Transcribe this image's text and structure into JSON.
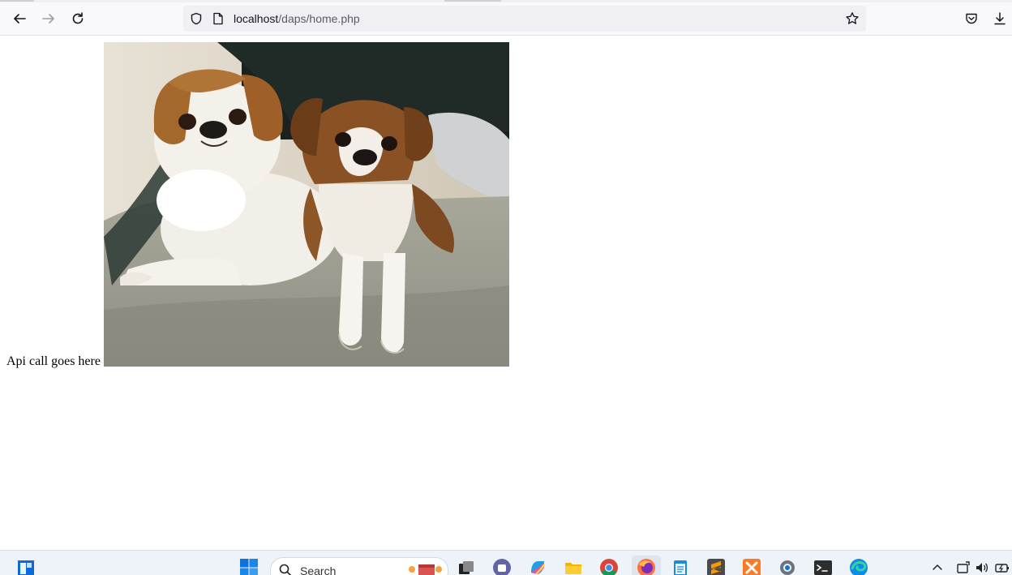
{
  "browser": {
    "url_host": "localhost",
    "url_path": "/daps/home.php",
    "icons": {
      "back": "back-arrow-icon",
      "forward": "forward-arrow-icon",
      "reload": "reload-icon",
      "shield": "shield-icon",
      "page": "page-icon",
      "bookmark": "star-icon",
      "pocket": "pocket-icon",
      "downloads": "download-icon"
    }
  },
  "page": {
    "api_text": "Api call goes here",
    "image_subject": "dog-photo"
  },
  "taskbar": {
    "search_label": "Search",
    "apps": [
      "start-icon",
      "task-view-icon",
      "teams-icon",
      "copilot-icon",
      "file-explorer-icon",
      "chrome-icon",
      "firefox-icon",
      "notepad-icon",
      "sublime-icon",
      "xampp-icon",
      "settings-icon",
      "terminal-icon",
      "edge-icon"
    ],
    "tray": [
      "widgets-icon",
      "chevron-up-icon",
      "network-icon",
      "volume-icon",
      "battery-icon"
    ]
  },
  "colors": {
    "toolbar_bg": "#f9f9fb",
    "urlbar_bg": "#f0f0f4",
    "taskbar_bg": "#eef2f9",
    "windows_blue": "#0078d4"
  }
}
